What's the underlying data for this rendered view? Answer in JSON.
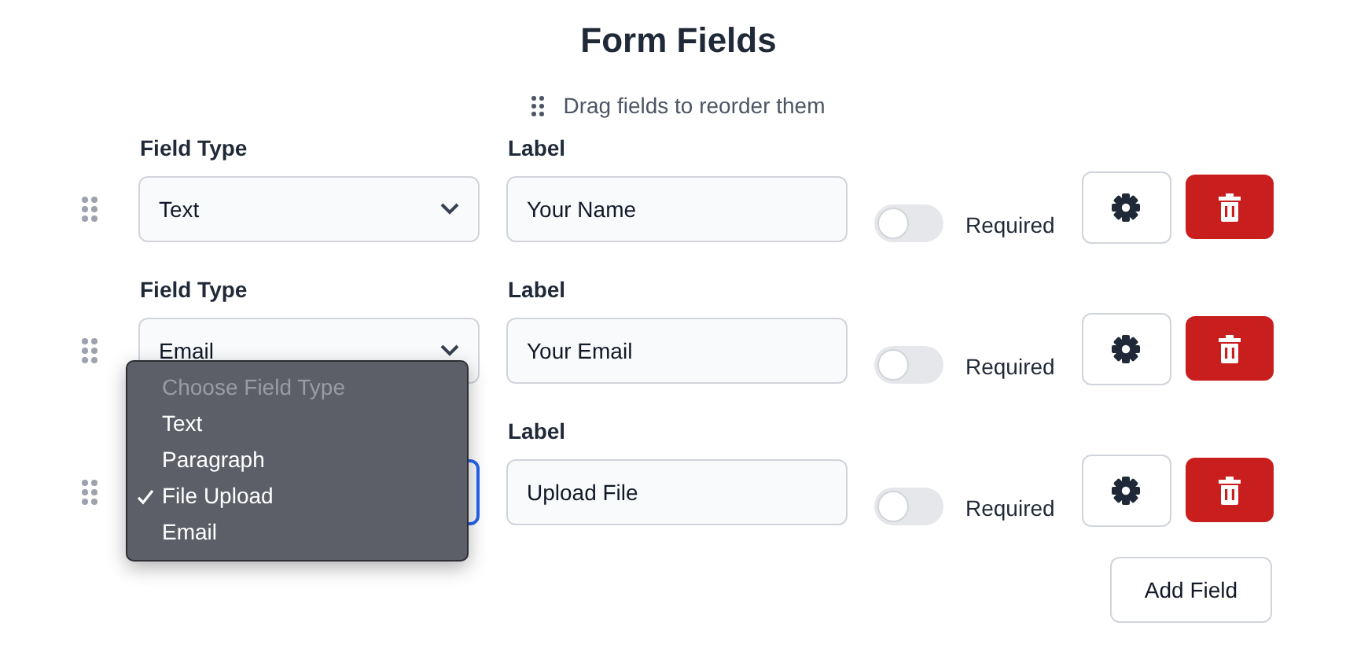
{
  "title": "Form Fields",
  "subtitle": "Drag fields to reorder them",
  "fields": [
    {
      "type_label": "Field Type",
      "type_value": "Text",
      "focused": false,
      "label_caption": "Label",
      "label_value": "Your Name",
      "required": false,
      "required_label": "Required"
    },
    {
      "type_label": "Field Type",
      "type_value": "Email",
      "focused": false,
      "label_caption": "Label",
      "label_value": "Your Email",
      "required": false,
      "required_label": "Required"
    },
    {
      "focused": true,
      "label_caption": "Label",
      "label_value": "Upload File",
      "required": false,
      "required_label": "Required"
    }
  ],
  "dropdown": {
    "options": [
      {
        "label": "Choose Field Type",
        "kind": "placeholder",
        "selected": false
      },
      {
        "label": "Text",
        "kind": "option",
        "selected": false
      },
      {
        "label": "Paragraph",
        "kind": "option",
        "selected": false
      },
      {
        "label": "File Upload",
        "kind": "option",
        "selected": true
      },
      {
        "label": "Email",
        "kind": "option",
        "selected": false
      }
    ]
  },
  "add_button": "Add Field"
}
